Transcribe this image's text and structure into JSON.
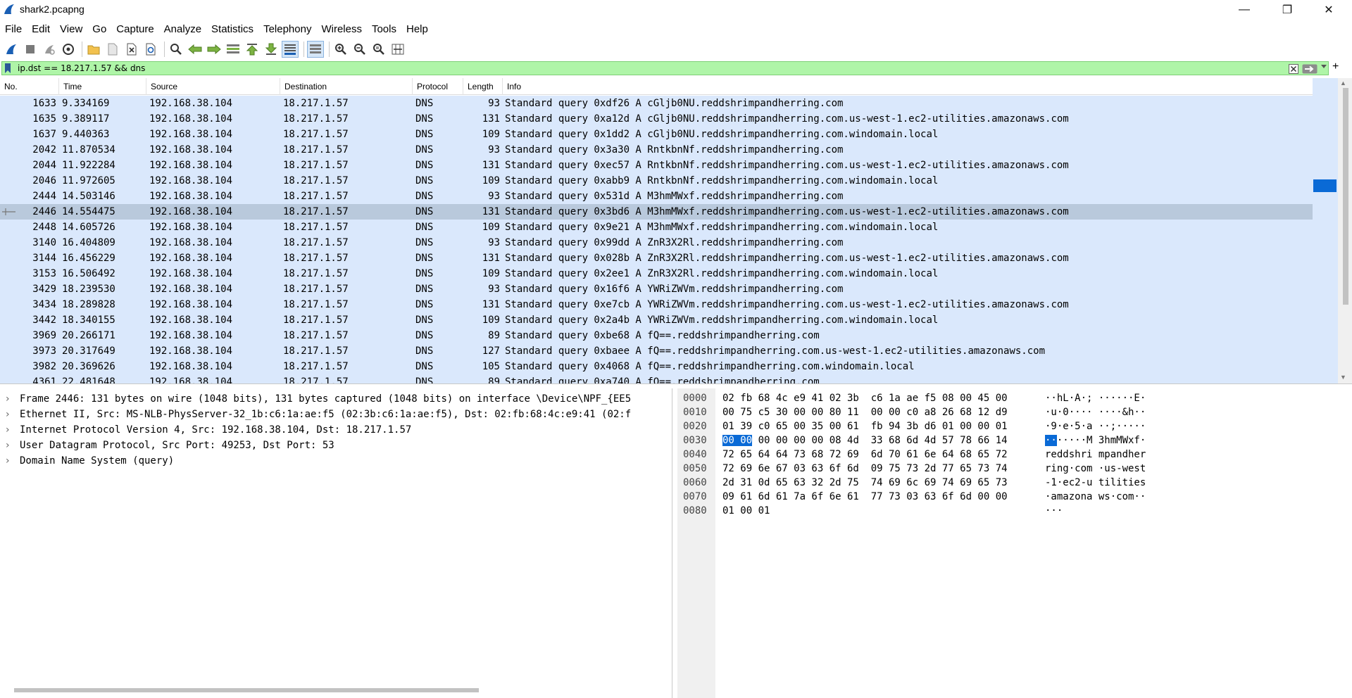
{
  "window": {
    "title": "shark2.pcapng",
    "controls": {
      "minimize": "—",
      "maximize": "❐",
      "close": "✕"
    }
  },
  "menu": [
    "File",
    "Edit",
    "View",
    "Go",
    "Capture",
    "Analyze",
    "Statistics",
    "Telephony",
    "Wireless",
    "Tools",
    "Help"
  ],
  "toolbar": {
    "icons": [
      "shark-fin-start-icon",
      "stop-capture-icon",
      "restart-capture-icon",
      "capture-options-icon",
      "open-file-icon",
      "save-file-icon",
      "close-file-icon",
      "reload-file-icon",
      "find-packet-icon",
      "go-back-icon",
      "go-forward-icon",
      "go-to-packet-icon",
      "go-first-icon",
      "go-last-icon",
      "autoscroll-icon",
      "colorize-icon",
      "zoom-in-icon",
      "zoom-out-icon",
      "zoom-normal-icon",
      "resize-columns-icon"
    ]
  },
  "filter": {
    "value": "ip.dst == 18.217.1.57 && dns",
    "bg_color": "#aff5a8"
  },
  "packet_list": {
    "columns": [
      "No.",
      "Time",
      "Source",
      "Destination",
      "Protocol",
      "Length",
      "Info"
    ],
    "row_color": "#dae8fc",
    "selected_color": "#b9c9dc",
    "rows": [
      {
        "no": "1633",
        "time": "9.334169",
        "src": "192.168.38.104",
        "dst": "18.217.1.57",
        "proto": "DNS",
        "len": "93",
        "info": "Standard query 0xdf26 A cGljb0NU.reddshrimpandherring.com"
      },
      {
        "no": "1635",
        "time": "9.389117",
        "src": "192.168.38.104",
        "dst": "18.217.1.57",
        "proto": "DNS",
        "len": "131",
        "info": "Standard query 0xa12d A cGljb0NU.reddshrimpandherring.com.us-west-1.ec2-utilities.amazonaws.com"
      },
      {
        "no": "1637",
        "time": "9.440363",
        "src": "192.168.38.104",
        "dst": "18.217.1.57",
        "proto": "DNS",
        "len": "109",
        "info": "Standard query 0x1dd2 A cGljb0NU.reddshrimpandherring.com.windomain.local"
      },
      {
        "no": "2042",
        "time": "11.870534",
        "src": "192.168.38.104",
        "dst": "18.217.1.57",
        "proto": "DNS",
        "len": "93",
        "info": "Standard query 0x3a30 A RntkbnNf.reddshrimpandherring.com"
      },
      {
        "no": "2044",
        "time": "11.922284",
        "src": "192.168.38.104",
        "dst": "18.217.1.57",
        "proto": "DNS",
        "len": "131",
        "info": "Standard query 0xec57 A RntkbnNf.reddshrimpandherring.com.us-west-1.ec2-utilities.amazonaws.com"
      },
      {
        "no": "2046",
        "time": "11.972605",
        "src": "192.168.38.104",
        "dst": "18.217.1.57",
        "proto": "DNS",
        "len": "109",
        "info": "Standard query 0xabb9 A RntkbnNf.reddshrimpandherring.com.windomain.local"
      },
      {
        "no": "2444",
        "time": "14.503146",
        "src": "192.168.38.104",
        "dst": "18.217.1.57",
        "proto": "DNS",
        "len": "93",
        "info": "Standard query 0x531d A M3hmMWxf.reddshrimpandherring.com"
      },
      {
        "no": "2446",
        "time": "14.554475",
        "src": "192.168.38.104",
        "dst": "18.217.1.57",
        "proto": "DNS",
        "len": "131",
        "info": "Standard query 0x3bd6 A M3hmMWxf.reddshrimpandherring.com.us-west-1.ec2-utilities.amazonaws.com",
        "selected": true
      },
      {
        "no": "2448",
        "time": "14.605726",
        "src": "192.168.38.104",
        "dst": "18.217.1.57",
        "proto": "DNS",
        "len": "109",
        "info": "Standard query 0x9e21 A M3hmMWxf.reddshrimpandherring.com.windomain.local"
      },
      {
        "no": "3140",
        "time": "16.404809",
        "src": "192.168.38.104",
        "dst": "18.217.1.57",
        "proto": "DNS",
        "len": "93",
        "info": "Standard query 0x99dd A ZnR3X2Rl.reddshrimpandherring.com"
      },
      {
        "no": "3144",
        "time": "16.456229",
        "src": "192.168.38.104",
        "dst": "18.217.1.57",
        "proto": "DNS",
        "len": "131",
        "info": "Standard query 0x028b A ZnR3X2Rl.reddshrimpandherring.com.us-west-1.ec2-utilities.amazonaws.com"
      },
      {
        "no": "3153",
        "time": "16.506492",
        "src": "192.168.38.104",
        "dst": "18.217.1.57",
        "proto": "DNS",
        "len": "109",
        "info": "Standard query 0x2ee1 A ZnR3X2Rl.reddshrimpandherring.com.windomain.local"
      },
      {
        "no": "3429",
        "time": "18.239530",
        "src": "192.168.38.104",
        "dst": "18.217.1.57",
        "proto": "DNS",
        "len": "93",
        "info": "Standard query 0x16f6 A YWRiZWVm.reddshrimpandherring.com"
      },
      {
        "no": "3434",
        "time": "18.289828",
        "src": "192.168.38.104",
        "dst": "18.217.1.57",
        "proto": "DNS",
        "len": "131",
        "info": "Standard query 0xe7cb A YWRiZWVm.reddshrimpandherring.com.us-west-1.ec2-utilities.amazonaws.com"
      },
      {
        "no": "3442",
        "time": "18.340155",
        "src": "192.168.38.104",
        "dst": "18.217.1.57",
        "proto": "DNS",
        "len": "109",
        "info": "Standard query 0x2a4b A YWRiZWVm.reddshrimpandherring.com.windomain.local"
      },
      {
        "no": "3969",
        "time": "20.266171",
        "src": "192.168.38.104",
        "dst": "18.217.1.57",
        "proto": "DNS",
        "len": "89",
        "info": "Standard query 0xbe68 A fQ==.reddshrimpandherring.com"
      },
      {
        "no": "3973",
        "time": "20.317649",
        "src": "192.168.38.104",
        "dst": "18.217.1.57",
        "proto": "DNS",
        "len": "127",
        "info": "Standard query 0xbaee A fQ==.reddshrimpandherring.com.us-west-1.ec2-utilities.amazonaws.com"
      },
      {
        "no": "3982",
        "time": "20.369626",
        "src": "192.168.38.104",
        "dst": "18.217.1.57",
        "proto": "DNS",
        "len": "105",
        "info": "Standard query 0x4068 A fQ==.reddshrimpandherring.com.windomain.local"
      },
      {
        "no": "4361",
        "time": "22.481648",
        "src": "192.168.38.104",
        "dst": "18.217.1.57",
        "proto": "DNS",
        "len": "89",
        "info": "Standard query 0xa740 A fQ==.reddshrimpandherring.com"
      }
    ]
  },
  "details": [
    "Frame 2446: 131 bytes on wire (1048 bits), 131 bytes captured (1048 bits) on interface \\Device\\NPF_{EE5",
    "Ethernet II, Src: MS-NLB-PhysServer-32_1b:c6:1a:ae:f5 (02:3b:c6:1a:ae:f5), Dst: 02:fb:68:4c:e9:41 (02:f",
    "Internet Protocol Version 4, Src: 192.168.38.104, Dst: 18.217.1.57",
    "User Datagram Protocol, Src Port: 49253, Dst Port: 53",
    "Domain Name System (query)"
  ],
  "hex": {
    "highlight_color": "#0a6ad6",
    "rows": [
      {
        "off": "0000",
        "pre": "02 fb 68 4c e9 41 02 3b  c6 1a ae f5 08 00 45 00",
        "hl": "",
        "post": "",
        "apre": "··hL·A·; ······E·",
        "ahl": "",
        "apost": ""
      },
      {
        "off": "0010",
        "pre": "00 75 c5 30 00 00 80 11  00 00 c0 a8 26 68 12 d9",
        "hl": "",
        "post": "",
        "apre": "·u·0···· ····&h··",
        "ahl": "",
        "apost": ""
      },
      {
        "off": "0020",
        "pre": "01 39 c0 65 00 35 00 61  fb 94 3b d6 01 00 00 01",
        "hl": "",
        "post": "",
        "apre": "·9·e·5·a ··;·····",
        "ahl": "",
        "apost": ""
      },
      {
        "off": "0030",
        "pre": "",
        "hl": "00 00",
        "post": " 00 00 00 00 08 4d  33 68 6d 4d 57 78 66 14",
        "apre": "",
        "ahl": "··",
        "apost": "·····M 3hmMWxf·"
      },
      {
        "off": "0040",
        "pre": "72 65 64 64 73 68 72 69  6d 70 61 6e 64 68 65 72",
        "hl": "",
        "post": "",
        "apre": "reddshri mpandher",
        "ahl": "",
        "apost": ""
      },
      {
        "off": "0050",
        "pre": "72 69 6e 67 03 63 6f 6d  09 75 73 2d 77 65 73 74",
        "hl": "",
        "post": "",
        "apre": "ring·com ·us-west",
        "ahl": "",
        "apost": ""
      },
      {
        "off": "0060",
        "pre": "2d 31 0d 65 63 32 2d 75  74 69 6c 69 74 69 65 73",
        "hl": "",
        "post": "",
        "apre": "-1·ec2-u tilities",
        "ahl": "",
        "apost": ""
      },
      {
        "off": "0070",
        "pre": "09 61 6d 61 7a 6f 6e 61  77 73 03 63 6f 6d 00 00",
        "hl": "",
        "post": "",
        "apre": "·amazona ws·com··",
        "ahl": "",
        "apost": ""
      },
      {
        "off": "0080",
        "pre": "01 00 01",
        "hl": "",
        "post": "",
        "apre": "···",
        "ahl": "",
        "apost": ""
      }
    ]
  }
}
